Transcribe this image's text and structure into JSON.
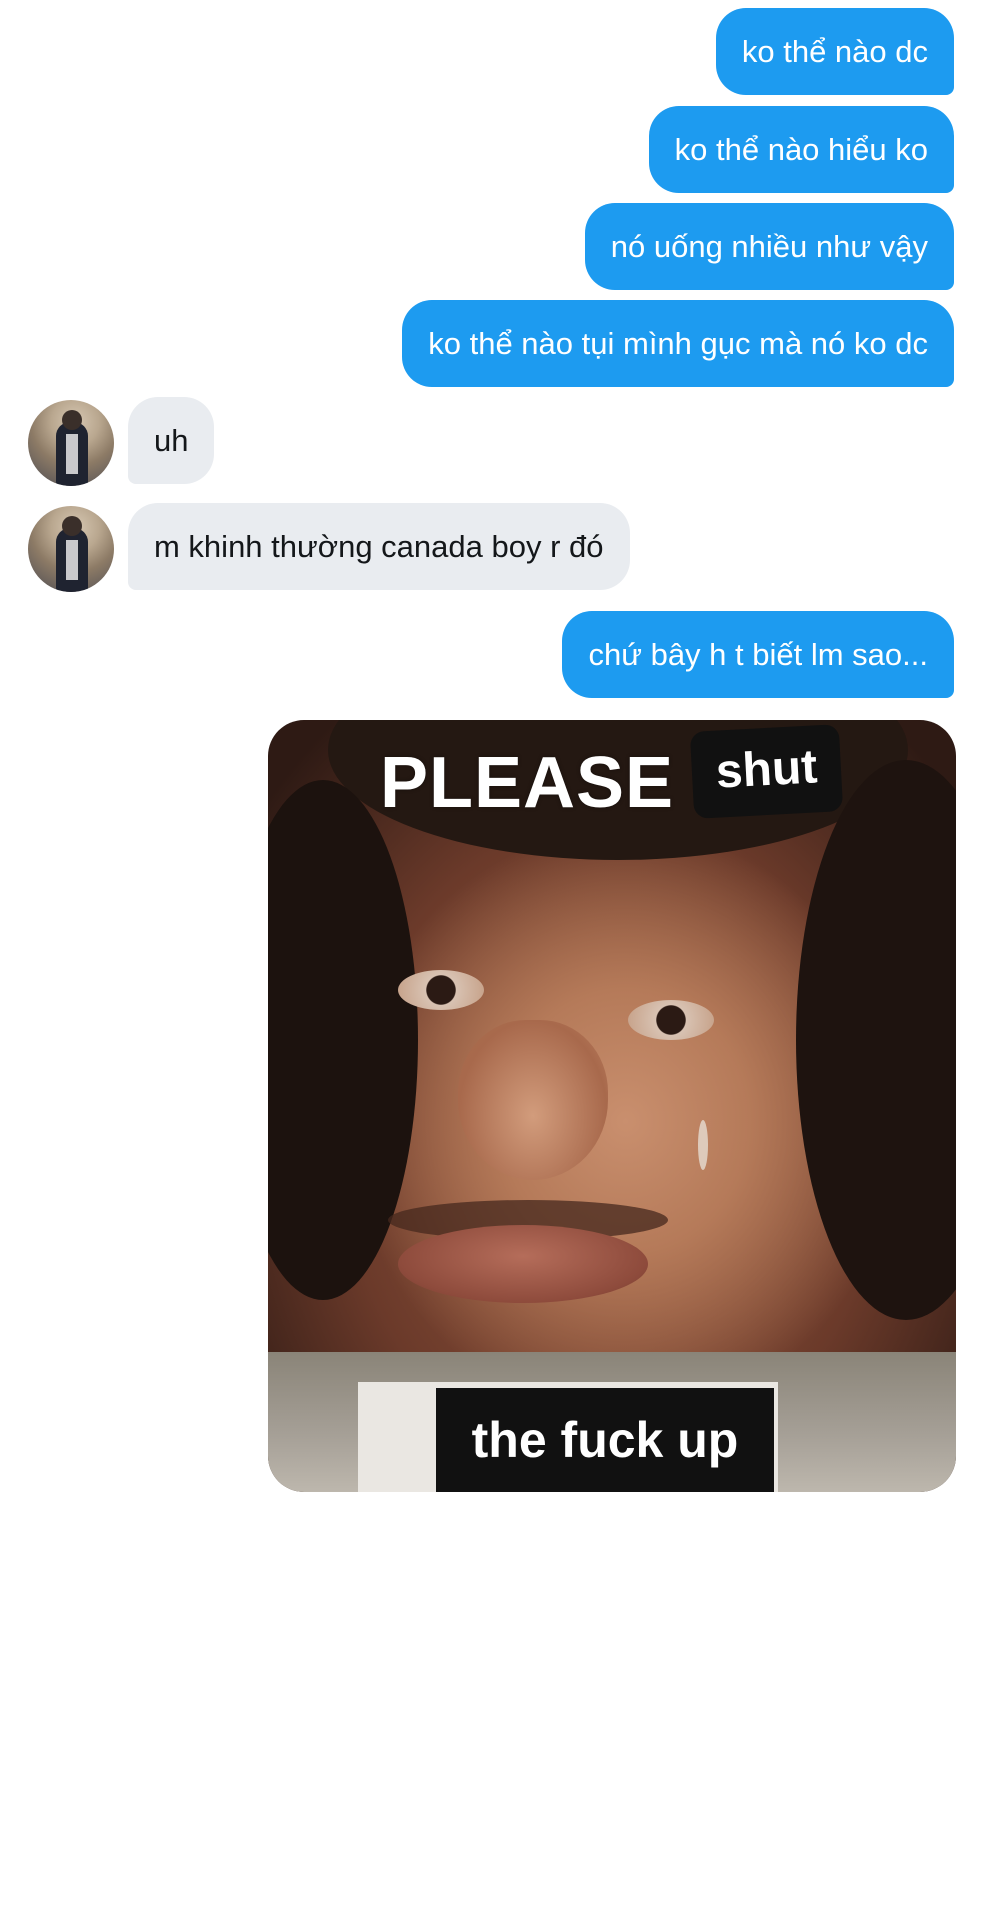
{
  "messages": [
    {
      "direction": "out",
      "text": "ko thể nào dc"
    },
    {
      "direction": "out",
      "text": "ko thể nào hiểu ko"
    },
    {
      "direction": "out",
      "text": "nó uống nhiều như vậy"
    },
    {
      "direction": "out",
      "text": "ko thể nào tụi mình gục mà nó ko dc"
    },
    {
      "direction": "in",
      "text": "uh"
    },
    {
      "direction": "in",
      "text": "m khinh thường canada boy r đó"
    },
    {
      "direction": "out",
      "text": "chứ bây h t biết lm sao..."
    }
  ],
  "meme": {
    "top_text": "PLEASE",
    "top_box_text": "shut",
    "bottom_text": "the fuck up"
  },
  "colors": {
    "outgoing_bubble": "#1d9bf0",
    "incoming_bubble": "#e9ecf0",
    "background": "#ffffff"
  }
}
